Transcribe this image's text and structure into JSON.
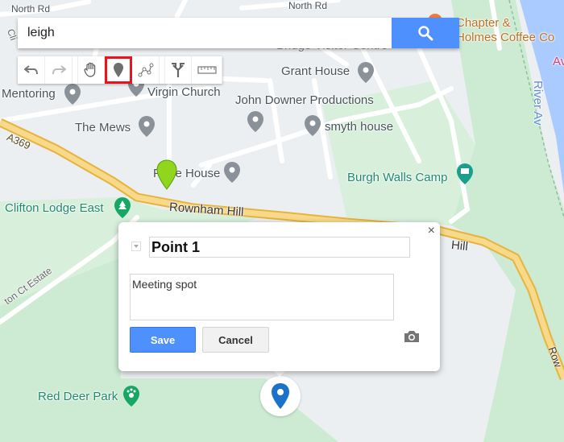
{
  "search": {
    "value": "leigh",
    "button_icon": "search-icon"
  },
  "toolbar": {
    "tools": [
      {
        "name": "undo",
        "icon": "undo-icon"
      },
      {
        "name": "redo",
        "icon": "redo-icon"
      },
      {
        "name": "pan",
        "icon": "hand-icon"
      },
      {
        "name": "add-marker",
        "icon": "marker-icon",
        "selected": true
      },
      {
        "name": "draw-line",
        "icon": "draw-line-icon"
      },
      {
        "name": "directions",
        "icon": "directions-icon"
      },
      {
        "name": "measure",
        "icon": "ruler-icon"
      }
    ],
    "selected_outline": "#e8141c"
  },
  "map": {
    "places": {
      "north_rd_1": "North Rd",
      "north_rd_2": "North Rd",
      "chapter": "Chapter &",
      "holmes_coffee": "Holmes Coffee Co",
      "bridge_visitor": "Bridge Visitor Centre",
      "grant_house": "Grant House",
      "mentoring": "Mentoring",
      "virgin_church": "Virgin Church",
      "john_downer": "John Downer Productions",
      "the_mews": "The Mews",
      "smyth_house": "smyth house",
      "a369": "A369",
      "frere_house": "Frere House",
      "burgh_walls_camp": "Burgh Walls Camp",
      "clifton_lodge_east": "Clifton Lodge East",
      "rownham_hill": "Rownham Hill",
      "hill": "Hill",
      "clifton_ct_estate": "ton Ct Estate",
      "red_deer_park": "Red Deer Park",
      "river_avon": "River Av",
      "row": "Row",
      "av": "Av",
      "cli": "Cli"
    },
    "colors": {
      "road_major": "#f5d27a",
      "road_edge": "#e8b84a",
      "water": "#aacbff",
      "park": "#cdebd3",
      "pin_grey": "#8a9198",
      "pin_green": "#16a765",
      "pin_teal": "#1a9e8e"
    }
  },
  "popup": {
    "title": "Point 1",
    "description": "Meeting spot",
    "save_label": "Save",
    "cancel_label": "Cancel",
    "close_label": "×",
    "icons": {
      "close": "close-icon",
      "camera": "camera-icon",
      "style": "dropdown-icon"
    }
  },
  "markers": {
    "new_marker_color": "#8fd61c",
    "selected_marker_color": "#1a73c8"
  }
}
